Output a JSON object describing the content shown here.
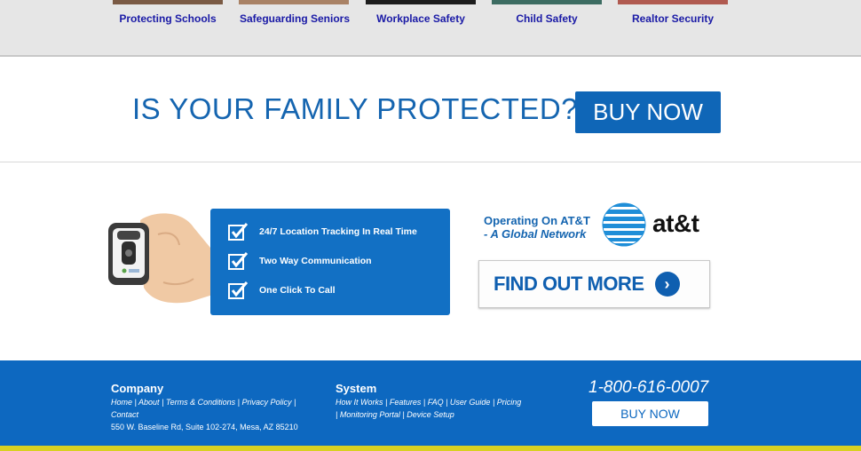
{
  "categories": [
    {
      "label": "Protecting Schools"
    },
    {
      "label": "Safeguarding Seniors"
    },
    {
      "label": "Workplace Safety"
    },
    {
      "label": "Child Safety"
    },
    {
      "label": "Realtor Security"
    }
  ],
  "hero": {
    "question": "IS YOUR FAMILY PROTECTED?",
    "buy_label": "BUY NOW"
  },
  "features": [
    "24/7 Location Tracking In Real Time",
    "Two Way Communication",
    "One Click To Call"
  ],
  "att": {
    "line1": "Operating On AT&T",
    "line2": "- A Global Network",
    "logo_text": "at&t"
  },
  "find_out": {
    "label": "FIND OUT MORE"
  },
  "footer": {
    "company": {
      "heading": "Company",
      "links": [
        "Home",
        "About",
        "Terms & Conditions",
        "Privacy Policy",
        "Contact"
      ],
      "address": "550 W. Baseline Rd, Suite 102-274,  Mesa, AZ 85210"
    },
    "system": {
      "heading": "System",
      "links": [
        "How It Works",
        "Features",
        "FAQ",
        "User Guide",
        "Pricing",
        "Monitoring Portal",
        "Device Setup"
      ]
    },
    "phone": "1-800-616-0007",
    "buy_label": "BUY NOW"
  },
  "colors": {
    "brand_blue": "#0f66b7",
    "footer_blue": "#0d68c0",
    "link_purple": "#1a1aa6"
  }
}
